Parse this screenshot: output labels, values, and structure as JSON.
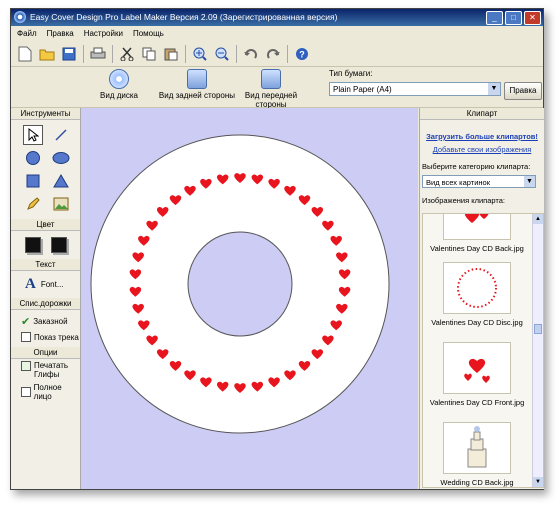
{
  "window": {
    "title": "Easy Cover Design Pro Label Maker Версия 2.09 (Зарегистрированная версия)"
  },
  "menu": [
    "Файл",
    "Правка",
    "Настройки",
    "Помощь"
  ],
  "views": {
    "disc": "Вид диска",
    "back": "Вид задней стороны",
    "front": "Вид передней стороны"
  },
  "paper": {
    "label": "Тип бумаги:",
    "value": "Plain Paper (A4)",
    "apply": "Правка"
  },
  "left": {
    "tools_title": "Инструменты",
    "color_title": "Цвет",
    "text_title": "Текст",
    "font_label": "Font...",
    "tracklist_title": "Спис.дорожки",
    "custom_label": "Заказной",
    "show_track_label": "Показ трека",
    "options_title": "Опции",
    "print_guides_label": "Печатать Глифы",
    "full_face_label": "Полное лицо"
  },
  "right": {
    "title": "Клипарт",
    "more_link": "Загрузить больше клипартов!",
    "add_link": "Добавьте свои изображения",
    "category_label": "Выберите категорию клипарта:",
    "category_value": "Вид всех картинок",
    "images_label": "Изображения клипарта:",
    "clips": [
      {
        "name": "Valentines Day CD Back.jpg"
      },
      {
        "name": "Valentines Day CD Disc.jpg"
      },
      {
        "name": "Valentines Day CD Front.jpg"
      },
      {
        "name": "Wedding CD Back.jpg"
      }
    ]
  },
  "colors": {
    "accent": "#0a246a",
    "canvas": "#ccccf4",
    "heart": "#e8141e",
    "link": "#1a3fb5"
  }
}
